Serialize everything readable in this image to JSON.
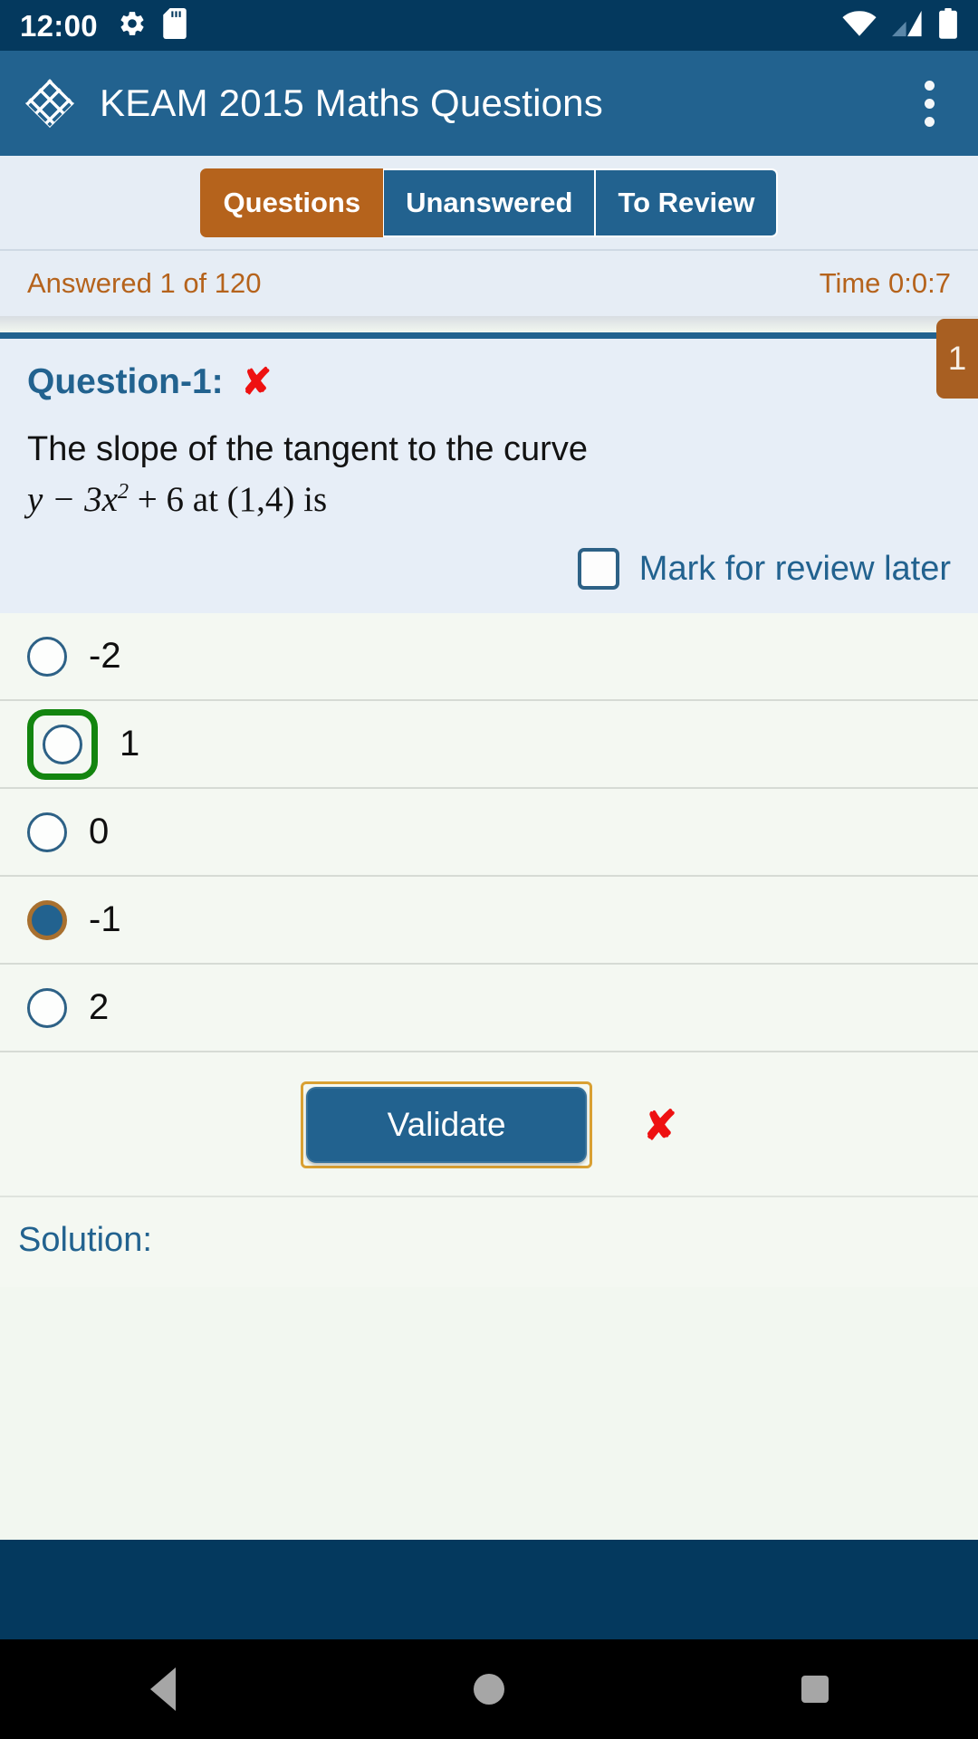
{
  "status_bar": {
    "clock": "12:00",
    "icons": [
      "settings-gear-icon",
      "sd-card-icon",
      "wifi-icon",
      "cell-signal-icon",
      "battery-icon"
    ]
  },
  "app_bar": {
    "logo": "lattice-diamond-logo",
    "title": "KEAM 2015 Maths Questions",
    "overflow": "more-options-icon"
  },
  "tabs": [
    {
      "label": "Questions",
      "active": true
    },
    {
      "label": "Unanswered",
      "active": false
    },
    {
      "label": "To Review",
      "active": false
    }
  ],
  "meta": {
    "answered": "Answered 1 of 120",
    "time": "Time 0:0:7"
  },
  "question": {
    "badge": "1",
    "label": "Question-1:",
    "result_mark": "✘",
    "text_line1": "The slope of the tangent to the curve",
    "math_prefix": "y − 3x",
    "math_exponent": "2",
    "math_suffix": " + 6 at (1,4) is",
    "mark_review_label": "Mark for review later",
    "mark_review_checked": false
  },
  "options": [
    {
      "label": "-2",
      "selected": false,
      "correct": false
    },
    {
      "label": "1",
      "selected": false,
      "correct": true
    },
    {
      "label": "0",
      "selected": false,
      "correct": false
    },
    {
      "label": "-1",
      "selected": true,
      "correct": false
    },
    {
      "label": "2",
      "selected": false,
      "correct": false
    }
  ],
  "validate": {
    "label": "Validate",
    "result_mark": "✘"
  },
  "solution": {
    "label": "Solution:"
  },
  "nav_bar": {
    "back": "back-triangle-icon",
    "home": "home-circle-icon",
    "recents": "recents-square-icon"
  },
  "colors": {
    "status_bar": "#04395e",
    "app_bar": "#22628f",
    "accent_orange": "#b5631c",
    "correct_green": "#13850f",
    "wrong_red": "#ee1111"
  }
}
